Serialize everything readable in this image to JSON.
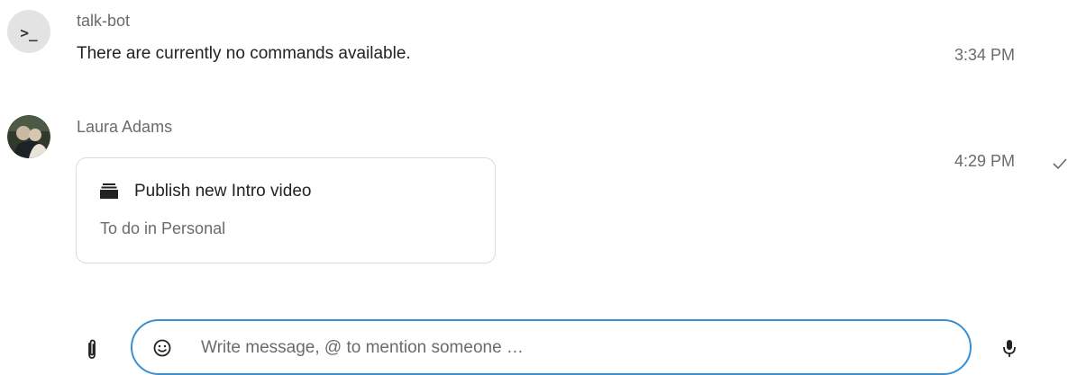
{
  "messages": [
    {
      "author": "talk-bot",
      "avatar_glyph": ">_",
      "text": "There are currently no commands available.",
      "time": "3:34 PM"
    },
    {
      "author": "Laura Adams",
      "time": "4:29 PM",
      "status": "sent",
      "card": {
        "title": "Publish new Intro video",
        "subtitle": "To do in Personal"
      }
    }
  ],
  "composer": {
    "placeholder": "Write message, @ to mention someone …",
    "value": ""
  },
  "colors": {
    "accent": "#3a8fd1",
    "muted_text": "#6b6b6b",
    "card_border": "#dcdcdc"
  },
  "icons": [
    "terminal-avatar",
    "checkmark-icon",
    "deck-stack-icon",
    "paperclip-icon",
    "emoji-icon",
    "microphone-icon"
  ]
}
